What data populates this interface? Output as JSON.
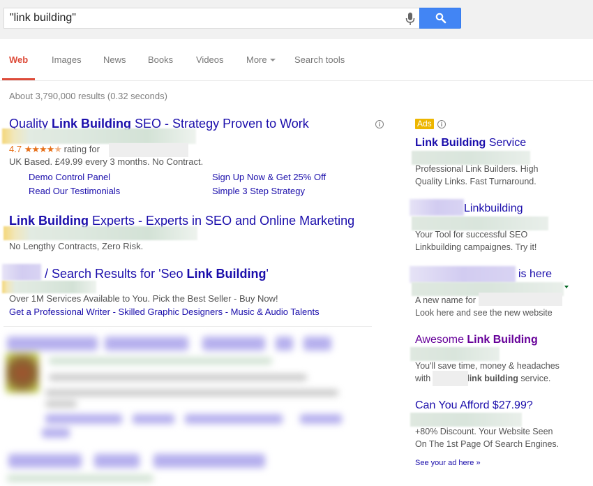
{
  "search": {
    "query": "\"link building\"",
    "mic_icon": "microphone-icon",
    "search_icon": "magnifier-icon"
  },
  "tabs": [
    {
      "label": "Web",
      "active": true
    },
    {
      "label": "Images"
    },
    {
      "label": "News"
    },
    {
      "label": "Books"
    },
    {
      "label": "Videos"
    },
    {
      "label": "More"
    },
    {
      "label": "Search tools"
    }
  ],
  "stats": "About 3,790,000 results (0.32 seconds)",
  "colors": {
    "link": "#1a0dab",
    "visited": "#660099",
    "active_tab": "#dd4b39",
    "search_button": "#4285f4",
    "ads_badge": "#edb600",
    "rating": "#e7711b"
  },
  "top_ads": [
    {
      "title_pre": "Quality ",
      "title_bold": "Link Building",
      "title_post": " SEO - Strategy Proven to Work",
      "rating_value": "4.7",
      "rating_stars": 4.7,
      "rating_label": "rating for",
      "description": "UK Based. £49.99 every 3 months. No Contract.",
      "sitelinks": [
        "Demo Control Panel",
        "Read Our Testimonials",
        "Sign Up Now & Get 25% Off",
        "Simple 3 Step Strategy"
      ]
    },
    {
      "title_bold": "Link Building",
      "title_post": " Experts - Experts in SEO and Online Marketing",
      "description": "No Lengthy Contracts, Zero Risk."
    },
    {
      "title_pre": "/ Search Results for 'Seo ",
      "title_bold": "Link Building",
      "title_post": "'",
      "description": "Over 1M Services Available to You. Pick the Best Seller - Buy Now!",
      "links": "Get a Professional Writer - Skilled Graphic Designers - Music & Audio Talents"
    }
  ],
  "side_ads": {
    "badge": "Ads",
    "items": [
      {
        "title_bold": "Link Building",
        "title_post": " Service",
        "lines": [
          "Professional Link Builders. High",
          "Quality Links. Fast Turnaround."
        ]
      },
      {
        "title_post": "Linkbuilding",
        "lines": [
          "Your Tool for successful SEO",
          "Linkbuilding campaignes. Try it!"
        ]
      },
      {
        "title_post": "is here",
        "lines": [
          "A new name for",
          "Look here and see the new website"
        ]
      },
      {
        "title_pre": "Awesome ",
        "title_bold": "Link Building",
        "lines": [
          "You'll save time, money & headaches",
          "with"
        ],
        "line2_bold": "link building",
        "line2_post": " service."
      },
      {
        "title_post": "Can You Afford $27.99?",
        "lines": [
          "+80% Discount. Your Website Seen",
          "On The 1st Page Of Search Engines."
        ]
      }
    ],
    "see_your_ad": "See your ad here »"
  }
}
